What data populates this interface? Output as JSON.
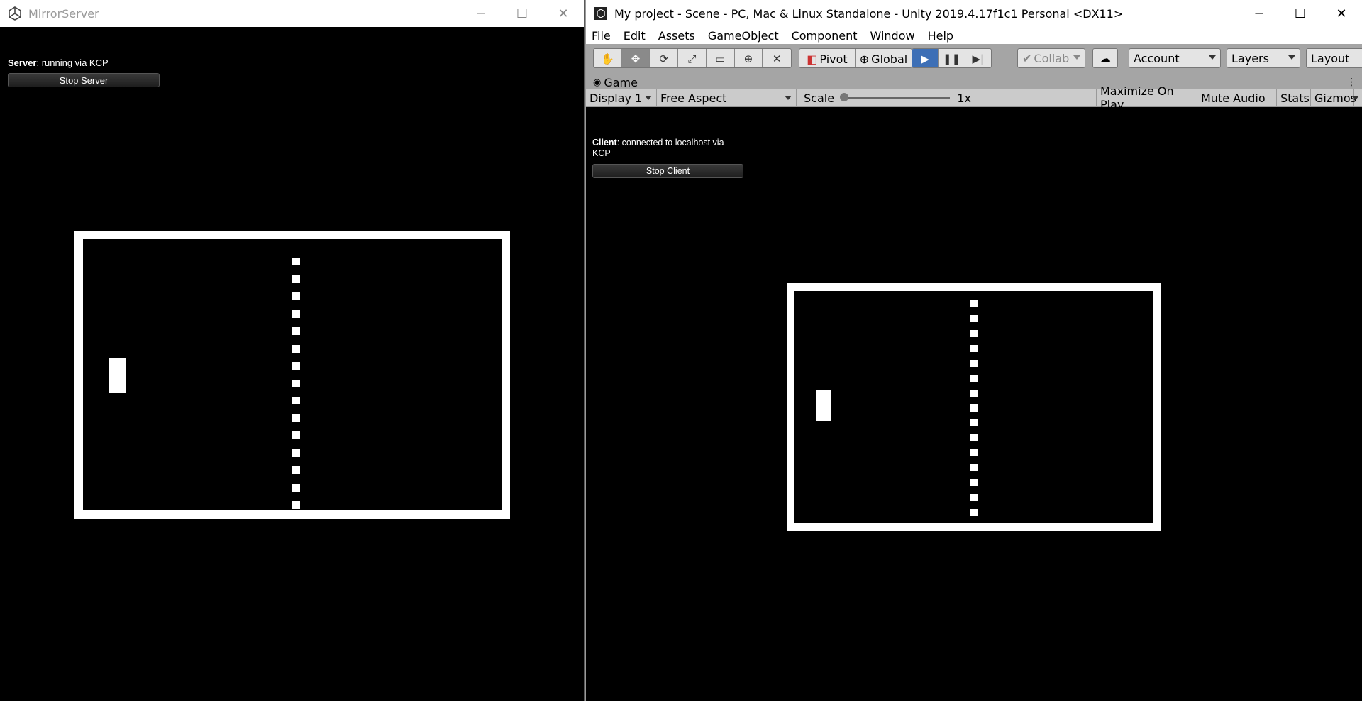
{
  "server_window": {
    "title": "MirrorServer",
    "status_label": "Server",
    "status_text": ": running via KCP",
    "button_label": "Stop Server",
    "controls": {
      "minimize": "─",
      "maximize": "☐",
      "close": "✕"
    }
  },
  "unity_window": {
    "title": "My project - Scene - PC, Mac & Linux Standalone - Unity 2019.4.17f1c1 Personal <DX11>",
    "controls": {
      "minimize": "─",
      "maximize": "☐",
      "close": "✕"
    },
    "menu": [
      "File",
      "Edit",
      "Assets",
      "GameObject",
      "Component",
      "Window",
      "Help"
    ],
    "toolbar": {
      "tools": [
        "hand-icon",
        "move-icon",
        "rotate-icon",
        "scale-icon",
        "rect-icon",
        "transform-icon",
        "custom-tool-icon"
      ],
      "pivot_label": "Pivot",
      "global_label": "Global",
      "collab_label": "Collab",
      "account_label": "Account",
      "layers_label": "Layers",
      "layout_label": "Layout"
    },
    "game_tab": {
      "label": "Game",
      "display": "Display 1",
      "aspect": "Free Aspect",
      "scale_label": "Scale",
      "scale_value": "1x",
      "maximize_on_play": "Maximize On Play",
      "mute_audio": "Mute Audio",
      "stats": "Stats",
      "gizmos": "Gizmos"
    },
    "client": {
      "status_label": "Client",
      "status_text_line1": ": connected to localhost via",
      "status_text_line2": "KCP",
      "button_label": "Stop Client"
    }
  },
  "colors": {
    "play_active": "#3d6fb6",
    "court": "#ffffff",
    "background": "#000000"
  }
}
